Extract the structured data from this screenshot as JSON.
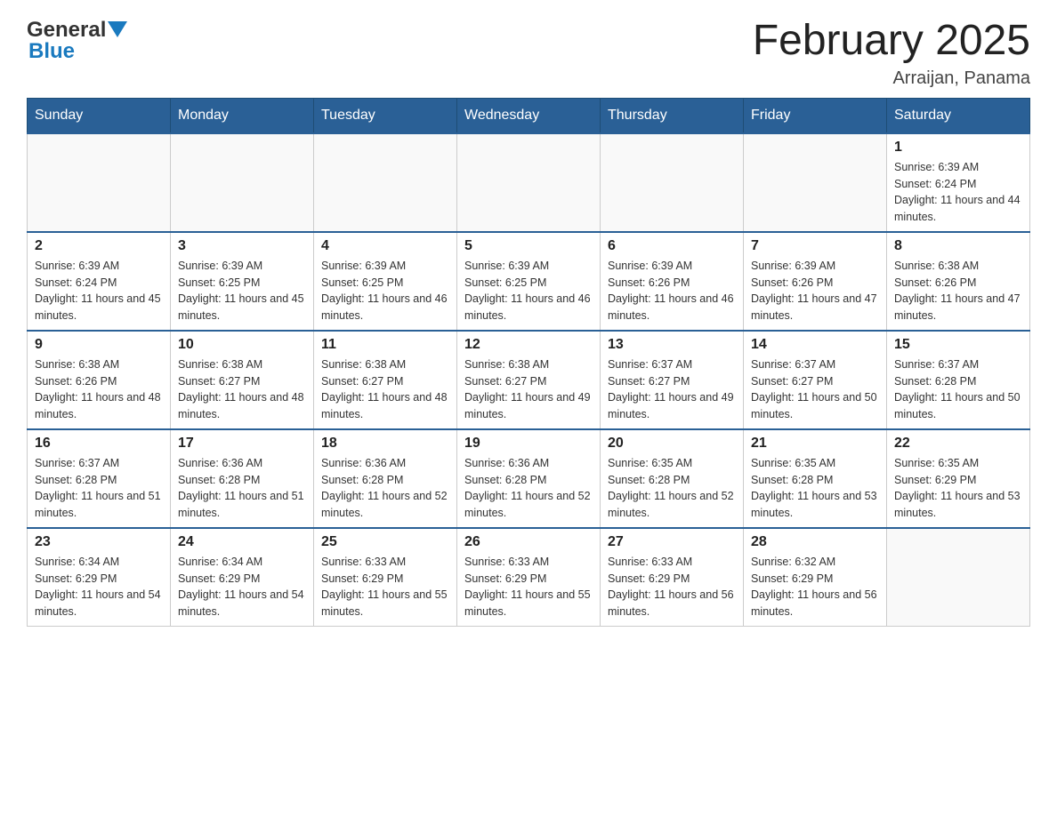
{
  "logo": {
    "general": "General",
    "blue": "Blue"
  },
  "header": {
    "title": "February 2025",
    "location": "Arraijan, Panama"
  },
  "days_of_week": [
    "Sunday",
    "Monday",
    "Tuesday",
    "Wednesday",
    "Thursday",
    "Friday",
    "Saturday"
  ],
  "weeks": [
    {
      "cells": [
        {
          "day": "",
          "info": ""
        },
        {
          "day": "",
          "info": ""
        },
        {
          "day": "",
          "info": ""
        },
        {
          "day": "",
          "info": ""
        },
        {
          "day": "",
          "info": ""
        },
        {
          "day": "",
          "info": ""
        },
        {
          "day": "1",
          "info": "Sunrise: 6:39 AM\nSunset: 6:24 PM\nDaylight: 11 hours and 44 minutes."
        }
      ]
    },
    {
      "cells": [
        {
          "day": "2",
          "info": "Sunrise: 6:39 AM\nSunset: 6:24 PM\nDaylight: 11 hours and 45 minutes."
        },
        {
          "day": "3",
          "info": "Sunrise: 6:39 AM\nSunset: 6:25 PM\nDaylight: 11 hours and 45 minutes."
        },
        {
          "day": "4",
          "info": "Sunrise: 6:39 AM\nSunset: 6:25 PM\nDaylight: 11 hours and 46 minutes."
        },
        {
          "day": "5",
          "info": "Sunrise: 6:39 AM\nSunset: 6:25 PM\nDaylight: 11 hours and 46 minutes."
        },
        {
          "day": "6",
          "info": "Sunrise: 6:39 AM\nSunset: 6:26 PM\nDaylight: 11 hours and 46 minutes."
        },
        {
          "day": "7",
          "info": "Sunrise: 6:39 AM\nSunset: 6:26 PM\nDaylight: 11 hours and 47 minutes."
        },
        {
          "day": "8",
          "info": "Sunrise: 6:38 AM\nSunset: 6:26 PM\nDaylight: 11 hours and 47 minutes."
        }
      ]
    },
    {
      "cells": [
        {
          "day": "9",
          "info": "Sunrise: 6:38 AM\nSunset: 6:26 PM\nDaylight: 11 hours and 48 minutes."
        },
        {
          "day": "10",
          "info": "Sunrise: 6:38 AM\nSunset: 6:27 PM\nDaylight: 11 hours and 48 minutes."
        },
        {
          "day": "11",
          "info": "Sunrise: 6:38 AM\nSunset: 6:27 PM\nDaylight: 11 hours and 48 minutes."
        },
        {
          "day": "12",
          "info": "Sunrise: 6:38 AM\nSunset: 6:27 PM\nDaylight: 11 hours and 49 minutes."
        },
        {
          "day": "13",
          "info": "Sunrise: 6:37 AM\nSunset: 6:27 PM\nDaylight: 11 hours and 49 minutes."
        },
        {
          "day": "14",
          "info": "Sunrise: 6:37 AM\nSunset: 6:27 PM\nDaylight: 11 hours and 50 minutes."
        },
        {
          "day": "15",
          "info": "Sunrise: 6:37 AM\nSunset: 6:28 PM\nDaylight: 11 hours and 50 minutes."
        }
      ]
    },
    {
      "cells": [
        {
          "day": "16",
          "info": "Sunrise: 6:37 AM\nSunset: 6:28 PM\nDaylight: 11 hours and 51 minutes."
        },
        {
          "day": "17",
          "info": "Sunrise: 6:36 AM\nSunset: 6:28 PM\nDaylight: 11 hours and 51 minutes."
        },
        {
          "day": "18",
          "info": "Sunrise: 6:36 AM\nSunset: 6:28 PM\nDaylight: 11 hours and 52 minutes."
        },
        {
          "day": "19",
          "info": "Sunrise: 6:36 AM\nSunset: 6:28 PM\nDaylight: 11 hours and 52 minutes."
        },
        {
          "day": "20",
          "info": "Sunrise: 6:35 AM\nSunset: 6:28 PM\nDaylight: 11 hours and 52 minutes."
        },
        {
          "day": "21",
          "info": "Sunrise: 6:35 AM\nSunset: 6:28 PM\nDaylight: 11 hours and 53 minutes."
        },
        {
          "day": "22",
          "info": "Sunrise: 6:35 AM\nSunset: 6:29 PM\nDaylight: 11 hours and 53 minutes."
        }
      ]
    },
    {
      "cells": [
        {
          "day": "23",
          "info": "Sunrise: 6:34 AM\nSunset: 6:29 PM\nDaylight: 11 hours and 54 minutes."
        },
        {
          "day": "24",
          "info": "Sunrise: 6:34 AM\nSunset: 6:29 PM\nDaylight: 11 hours and 54 minutes."
        },
        {
          "day": "25",
          "info": "Sunrise: 6:33 AM\nSunset: 6:29 PM\nDaylight: 11 hours and 55 minutes."
        },
        {
          "day": "26",
          "info": "Sunrise: 6:33 AM\nSunset: 6:29 PM\nDaylight: 11 hours and 55 minutes."
        },
        {
          "day": "27",
          "info": "Sunrise: 6:33 AM\nSunset: 6:29 PM\nDaylight: 11 hours and 56 minutes."
        },
        {
          "day": "28",
          "info": "Sunrise: 6:32 AM\nSunset: 6:29 PM\nDaylight: 11 hours and 56 minutes."
        },
        {
          "day": "",
          "info": ""
        }
      ]
    }
  ]
}
